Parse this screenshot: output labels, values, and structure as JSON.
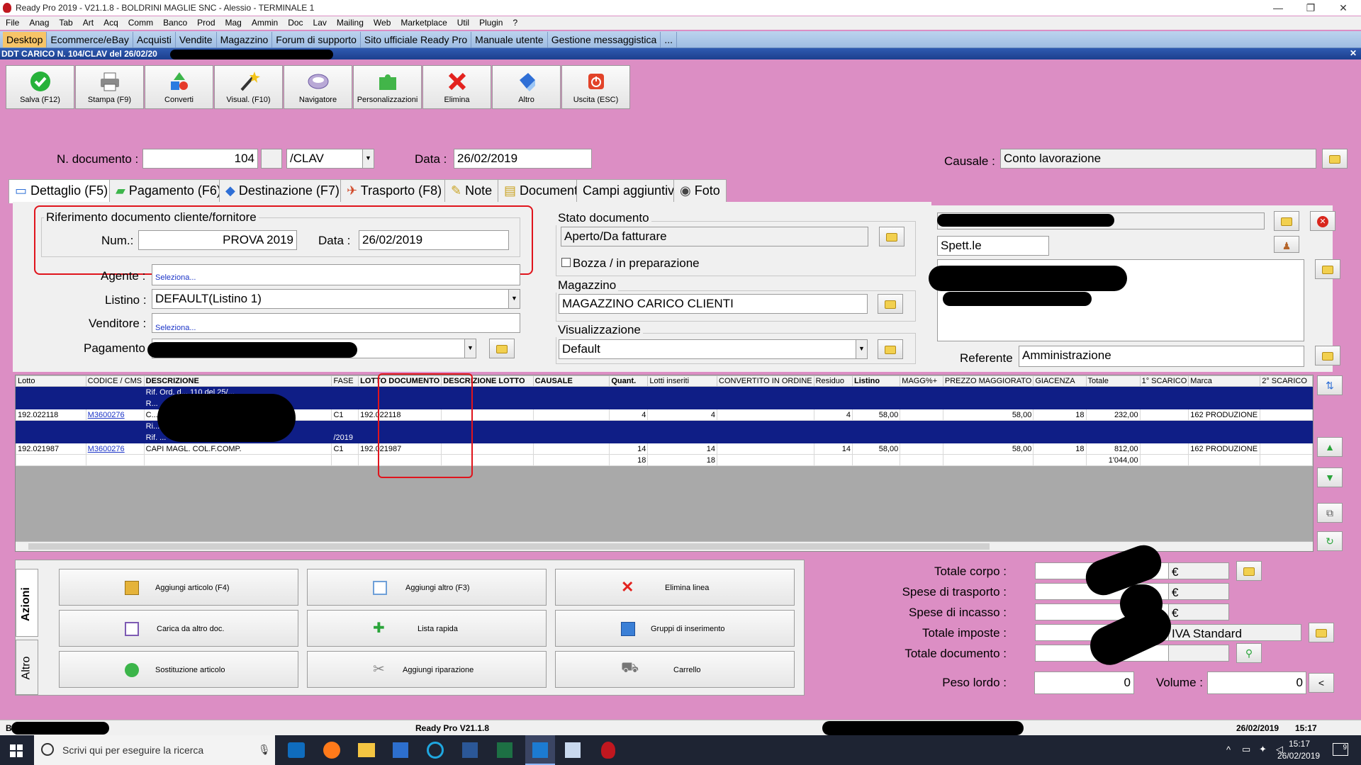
{
  "window": {
    "title": "Ready Pro 2019 - V21.1.8 - BOLDRINI MAGLIE SNC - Alessio - TERMINALE 1",
    "minimize": "—",
    "restore": "❐",
    "close": "✕"
  },
  "menu": [
    "File",
    "Anag",
    "Tab",
    "Art",
    "Acq",
    "Comm",
    "Banco",
    "Prod",
    "Mag",
    "Ammin",
    "Doc",
    "Lav",
    "Mailing",
    "Web",
    "Marketplace",
    "Util",
    "Plugin",
    "?"
  ],
  "nav_tabs": [
    "Desktop",
    "Ecommerce/eBay",
    "Acquisti",
    "Vendite",
    "Magazzino",
    "Forum di supporto",
    "Sito ufficiale Ready Pro",
    "Manuale utente",
    "Gestione messaggistica",
    "..."
  ],
  "doc_title": "DDT CARICO N. 104/CLAV del 26/02/20",
  "doc_close": "✕",
  "toolbar": [
    {
      "label": "Salva (F12)",
      "icon": "check-icon"
    },
    {
      "label": "Stampa (F9)",
      "icon": "printer-icon"
    },
    {
      "label": "Converti",
      "icon": "convert-icon"
    },
    {
      "label": "Visual. (F10)",
      "icon": "wand-icon"
    },
    {
      "label": "Navigatore",
      "icon": "navigator-icon"
    },
    {
      "label": "Personalizzazioni",
      "icon": "puzzle-icon"
    },
    {
      "label": "Elimina",
      "icon": "delete-icon"
    },
    {
      "label": "Altro",
      "icon": "more-icon"
    },
    {
      "label": "Uscita (ESC)",
      "icon": "exit-icon"
    }
  ],
  "header": {
    "ndoc_label": "N. documento :",
    "ndoc_value": "104",
    "series_value": "/CLAV",
    "data_label": "Data :",
    "data_value": "26/02/2019",
    "causale_label": "Causale :",
    "causale_value": "Conto lavorazione"
  },
  "tabs": [
    "Dettaglio (F5)",
    "Pagamento (F6)",
    "Destinazione (F7)",
    "Trasporto (F8)",
    "Note",
    "Documenti",
    "Campi aggiuntivi",
    "Foto"
  ],
  "ref": {
    "title": "Riferimento documento cliente/fornitore",
    "num_label": "Num.:",
    "num_value": "PROVA 2019",
    "data_label": "Data :",
    "data_value": "26/02/2019"
  },
  "fields": {
    "agente_label": "Agente :",
    "agente_value": "Seleziona...",
    "listino_label": "Listino :",
    "listino_value": "DEFAULT(Listino 1)",
    "venditore_label": "Venditore :",
    "venditore_value": "Seleziona...",
    "pagamento_label": "Pagamento"
  },
  "stato": {
    "title": "Stato documento",
    "value": "Aperto/Da fatturare",
    "bozza": "Bozza / in preparazione"
  },
  "magazzino": {
    "title": "Magazzino",
    "value": "MAGAZZINO CARICO CLIENTI"
  },
  "visualizzazione": {
    "title": "Visualizzazione",
    "value": "Default"
  },
  "cliente": {
    "spett": "Spett.le",
    "referente_label": "Referente",
    "referente_value": "Amministrazione"
  },
  "grid": {
    "columns": [
      "Lotto",
      "CODICE / CMS",
      "DESCRIZIONE",
      "FASE",
      "LOTTO DOCUMENTO",
      "DESCRIZIONE LOTTO",
      "CAUSALE",
      "Quant.",
      "Lotti inseriti",
      "CONVERTITO IN ORDINE",
      "Residuo",
      "Listino",
      "MAGG%+",
      "PREZZO MAGGIORATO",
      "GIACENZA",
      "Totale",
      "1° SCARICO",
      "Marca",
      "2° SCARICO"
    ],
    "rows": [
      {
        "sel": true,
        "cells": [
          "",
          "",
          "Rif. Ord. d... 110 del 25/...",
          "",
          "",
          "",
          "",
          "",
          "",
          "",
          "",
          "",
          "",
          "",
          "",
          "",
          "",
          "",
          ""
        ]
      },
      {
        "sel": true,
        "cells": [
          "",
          "",
          "R...",
          "",
          "",
          "",
          "",
          "",
          "",
          "",
          "",
          "",
          "",
          "",
          "",
          "",
          "",
          "",
          ""
        ]
      },
      {
        "sel": false,
        "cells": [
          "192.022118",
          "M3600276",
          "C...",
          "C1",
          "192.022118",
          "",
          "",
          "4",
          "4",
          "",
          "4",
          "58,00",
          "",
          "58,00",
          "18",
          "232,00",
          "",
          "162 PRODUZIONE",
          ""
        ]
      },
      {
        "sel": true,
        "cells": [
          "",
          "",
          "Ri...",
          "",
          "",
          "",
          "",
          "",
          "",
          "",
          "",
          "",
          "",
          "",
          "",
          "",
          "",
          "",
          ""
        ]
      },
      {
        "sel": true,
        "cells": [
          "",
          "",
          "Rif. ...",
          "/2019",
          "",
          "",
          "",
          "",
          "",
          "",
          "",
          "",
          "",
          "",
          "",
          "",
          "",
          "",
          ""
        ]
      },
      {
        "sel": false,
        "cells": [
          "192.021987",
          "M3600276",
          "CAPI MAGL. COL.F.COMP.",
          "C1",
          "192.021987",
          "",
          "",
          "14",
          "14",
          "",
          "14",
          "58,00",
          "",
          "58,00",
          "18",
          "812,00",
          "",
          "162 PRODUZIONE",
          ""
        ]
      },
      {
        "sel": false,
        "cells": [
          "",
          "",
          "",
          "",
          "",
          "",
          "",
          "18",
          "18",
          "",
          "",
          "",
          "",
          "",
          "",
          "1'044,00",
          "",
          "",
          ""
        ]
      }
    ]
  },
  "actions": {
    "vtab_1": "Azioni",
    "vtab_2": "Altro",
    "buttons": [
      {
        "label": "Aggiungi articolo (F4)",
        "icon": "add-article-icon"
      },
      {
        "label": "Aggiungi altro (F3)",
        "icon": "add-other-icon"
      },
      {
        "label": "Elimina linea",
        "icon": "delete-line-icon"
      },
      {
        "label": "Carica da altro doc.",
        "icon": "load-doc-icon"
      },
      {
        "label": "Lista rapida",
        "icon": "quick-list-icon"
      },
      {
        "label": "Gruppi di inserimento",
        "icon": "groups-icon"
      },
      {
        "label": "Sostituzione articolo",
        "icon": "replace-icon"
      },
      {
        "label": "Aggiungi riparazione",
        "icon": "repair-icon"
      },
      {
        "label": "Carrello",
        "icon": "cart-icon"
      }
    ]
  },
  "totals": {
    "corpo": "Totale corpo :",
    "trasporto": "Spese di trasporto :",
    "incasso": "Spese di incasso :",
    "imposte": "Totale imposte :",
    "iva": "IVA Standard",
    "documento": "Totale documento :",
    "peso_label": "Peso lordo :",
    "peso_value": "0",
    "volume_label": "Volume :",
    "volume_value": "0",
    "euro": "€",
    "lt": "<"
  },
  "status": {
    "left": "B",
    "center": "Ready Pro V21.1.8",
    "date": "26/02/2019",
    "time": "15:17"
  },
  "taskbar": {
    "search": "Scrivi qui per eseguire la ricerca",
    "time": "15:17",
    "date": "26/02/2019",
    "notif": "9"
  },
  "colors": {
    "background": "#dc8ec4",
    "accent_tab": "#f7c468",
    "selection": "#0f1e86",
    "highlight": "#e0141c"
  }
}
